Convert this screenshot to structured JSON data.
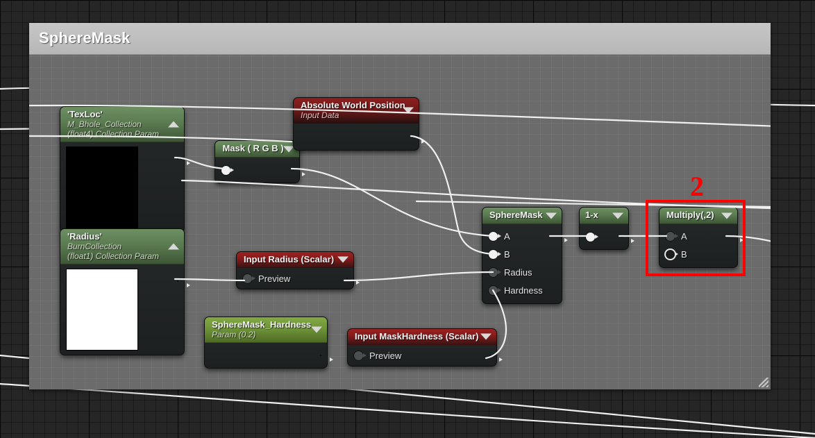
{
  "panel": {
    "title": "SphereMask",
    "resize_grip": "resize-grip"
  },
  "annotation": {
    "label": "2",
    "color": "#fb0000",
    "highlight_target": "Multiply(,2)",
    "highlight_color": "#ff0000"
  },
  "nodes": [
    {
      "id": "texloc",
      "title": "'TexLoc'",
      "subtitle_line1": "M_Bhole_Collection",
      "subtitle_line2": "(float4) Collection Param",
      "header_color": "#5b7b51",
      "caret": "chevron-up-icon",
      "preview_color": "#000000",
      "output_pin": "connected"
    },
    {
      "id": "radius",
      "title": "'Radius'",
      "subtitle_line1": "BurnCollection",
      "subtitle_line2": "(float1) Collection Param",
      "header_color": "#5b7b51",
      "caret": "chevron-up-icon",
      "preview_color": "#ffffff",
      "output_pin": "connected"
    },
    {
      "id": "mask",
      "title": "Mask ( R G B )",
      "header_color": "#5b7b51",
      "caret": "chevron-down-icon",
      "input_pin": "connected",
      "output_pin": "connected"
    },
    {
      "id": "absolute-world-position",
      "title": "Absolute World Position",
      "subtitle_line1": "Input Data",
      "header_color": "#841a1a",
      "caret": "chevron-down-icon",
      "output_pin": "connected"
    },
    {
      "id": "input-radius",
      "title": "Input Radius (Scalar)",
      "header_color": "#9c2222",
      "caret": "chevron-down-icon",
      "pin_label": "Preview",
      "input_pin": "unconnected",
      "output_pin": "connected"
    },
    {
      "id": "spheremask-hardness",
      "title": "SphereMask_Hardness",
      "subtitle_line1": "Param (0.2)",
      "header_color": "#6f9439",
      "caret": "chevron-down-icon",
      "output_pin": "connected"
    },
    {
      "id": "input-maskhardness",
      "title": "Input MaskHardness (Scalar)",
      "header_color": "#9c2222",
      "caret": "chevron-down-icon",
      "pin_label": "Preview",
      "input_pin": "unconnected",
      "output_pin": "connected"
    },
    {
      "id": "spheremask",
      "title": "SphereMask",
      "header_color": "#5b7b51",
      "caret": "chevron-down-icon",
      "pins": [
        {
          "label": "A",
          "state": "connected"
        },
        {
          "label": "B",
          "state": "connected"
        },
        {
          "label": "Radius",
          "state": "unconnected"
        },
        {
          "label": "Hardness",
          "state": "unconnected"
        }
      ],
      "output_pin": "connected"
    },
    {
      "id": "one-minus",
      "title": "1-x",
      "header_color": "#5b7b51",
      "caret": "chevron-down-icon",
      "input_pin": "connected",
      "output_pin": "connected"
    },
    {
      "id": "multiply",
      "title": "Multiply(,2)",
      "header_color": "#5b7b51",
      "caret": "chevron-down-icon",
      "pins": [
        {
          "label": "A",
          "state": "unconnected"
        },
        {
          "label": "B",
          "state": "hollow"
        }
      ],
      "output_pin": "connected",
      "selected": true
    }
  ]
}
